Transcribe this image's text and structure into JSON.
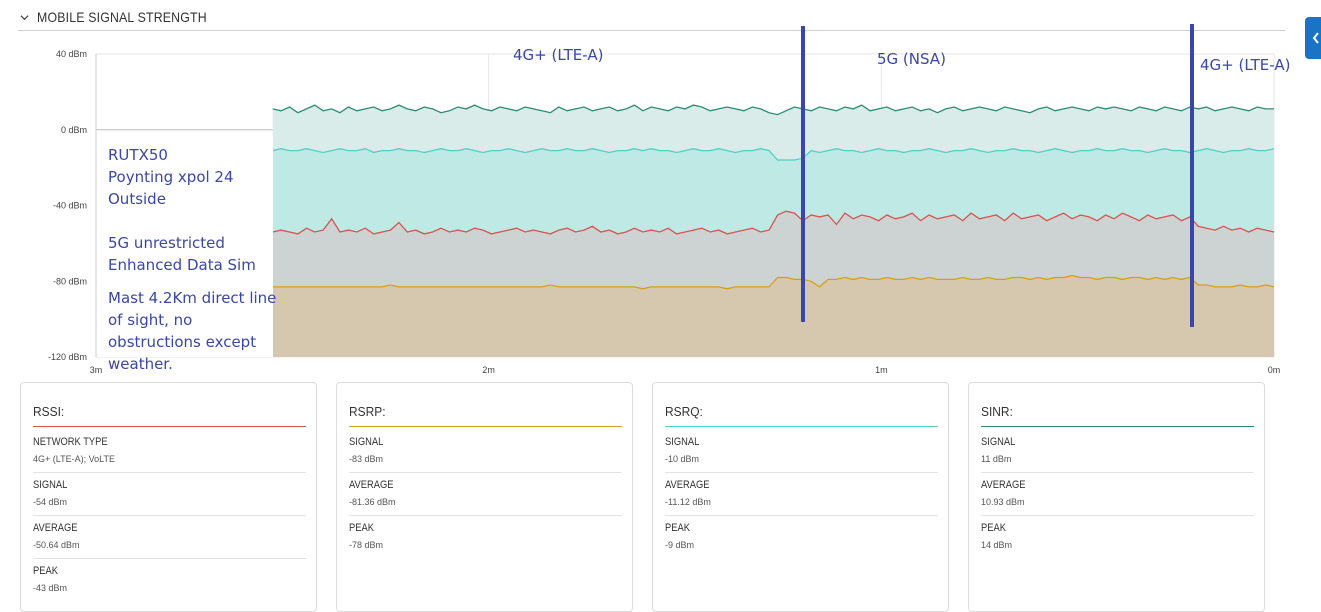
{
  "section": {
    "title": "MOBILE SIGNAL STRENGTH"
  },
  "colors": {
    "rssi": "#d9534f",
    "rsrp": "#d4a017",
    "rsrq": "#4dd0c8",
    "sinr": "#2e8b74",
    "overlay": "#3a46a8",
    "side_tab": "#1a73c5"
  },
  "icons": {
    "collapse": "chevron-down-icon",
    "side_tab": "chevron-left-icon"
  },
  "chart_data": {
    "type": "area",
    "x_ticks": [
      "3m",
      "2m",
      "1m",
      "0m"
    ],
    "y_ticks": [
      "40 dBm",
      "0 dBm",
      "-40 dBm",
      "-80 dBm",
      "-120 dBm"
    ],
    "ylim": [
      -120,
      40
    ],
    "xlim_minutes_ago": [
      3,
      0
    ],
    "data_start_minutes_ago": 2.55,
    "series": [
      {
        "name": "SINR",
        "key": "sinr",
        "values": [
          11,
          10,
          12,
          9,
          11,
          13,
          10,
          11,
          9,
          12,
          10,
          11,
          12,
          10,
          11,
          13,
          11,
          10,
          12,
          11,
          9,
          10,
          12,
          11,
          13,
          11,
          10,
          12,
          11,
          10,
          12,
          11,
          10,
          9,
          12,
          10,
          11,
          12,
          10,
          11,
          12,
          10,
          11,
          13,
          10,
          12,
          11,
          10,
          12,
          11,
          13,
          12,
          10,
          11,
          12,
          11,
          10,
          12,
          11,
          9,
          8,
          10,
          12,
          11,
          10,
          12,
          11,
          10,
          12,
          11,
          13,
          10,
          11,
          12,
          10,
          11,
          12,
          10,
          11,
          9,
          11,
          12,
          10,
          11,
          12,
          11,
          10,
          12,
          11,
          10,
          9,
          11,
          12,
          10,
          11,
          12,
          11,
          10,
          12,
          11,
          12,
          11,
          10,
          12,
          11,
          10,
          12,
          11,
          10,
          12,
          11,
          12,
          10,
          11,
          12,
          11,
          10,
          12,
          11,
          11
        ]
      },
      {
        "name": "RSRQ",
        "key": "rsrq",
        "values": [
          -11,
          -10,
          -11,
          -11,
          -10,
          -11,
          -12,
          -11,
          -10,
          -11,
          -11,
          -10,
          -12,
          -11,
          -11,
          -10,
          -11,
          -11,
          -12,
          -11,
          -10,
          -11,
          -11,
          -10,
          -11,
          -12,
          -11,
          -11,
          -10,
          -11,
          -12,
          -11,
          -10,
          -11,
          -11,
          -10,
          -11,
          -11,
          -10,
          -11,
          -12,
          -11,
          -11,
          -10,
          -11,
          -10,
          -11,
          -11,
          -12,
          -11,
          -10,
          -11,
          -11,
          -10,
          -11,
          -12,
          -11,
          -11,
          -10,
          -11,
          -16,
          -16,
          -16,
          -15,
          -11,
          -12,
          -11,
          -10,
          -11,
          -11,
          -12,
          -11,
          -10,
          -11,
          -11,
          -12,
          -11,
          -11,
          -10,
          -11,
          -12,
          -11,
          -11,
          -10,
          -11,
          -12,
          -11,
          -11,
          -10,
          -11,
          -11,
          -12,
          -11,
          -10,
          -11,
          -12,
          -11,
          -11,
          -10,
          -11,
          -11,
          -10,
          -11,
          -11,
          -12,
          -11,
          -10,
          -11,
          -11,
          -12,
          -11,
          -10,
          -11,
          -12,
          -11,
          -11,
          -10,
          -11,
          -11,
          -10
        ]
      },
      {
        "name": "RSSI",
        "key": "rssi",
        "values": [
          -54,
          -53,
          -54,
          -55,
          -52,
          -54,
          -53,
          -47,
          -54,
          -53,
          -54,
          -52,
          -55,
          -54,
          -53,
          -49,
          -54,
          -53,
          -55,
          -54,
          -52,
          -54,
          -53,
          -54,
          -52,
          -53,
          -55,
          -54,
          -53,
          -52,
          -54,
          -53,
          -54,
          -55,
          -53,
          -52,
          -54,
          -53,
          -51,
          -54,
          -53,
          -55,
          -54,
          -52,
          -54,
          -53,
          -54,
          -52,
          -55,
          -54,
          -53,
          -52,
          -54,
          -53,
          -55,
          -54,
          -53,
          -52,
          -54,
          -53,
          -45,
          -43,
          -44,
          -48,
          -45,
          -46,
          -45,
          -50,
          -44,
          -47,
          -45,
          -46,
          -48,
          -45,
          -47,
          -46,
          -44,
          -48,
          -45,
          -47,
          -46,
          -45,
          -48,
          -44,
          -47,
          -46,
          -45,
          -48,
          -44,
          -47,
          -46,
          -45,
          -48,
          -46,
          -44,
          -47,
          -45,
          -46,
          -48,
          -45,
          -47,
          -44,
          -46,
          -48,
          -45,
          -47,
          -46,
          -45,
          -48,
          -46,
          -51,
          -52,
          -53,
          -51,
          -53,
          -52,
          -54,
          -52,
          -53,
          -54
        ]
      },
      {
        "name": "RSRP",
        "key": "rsrp",
        "values": [
          -83,
          -83,
          -83,
          -83,
          -83,
          -83,
          -83,
          -83,
          -83,
          -83,
          -83,
          -83,
          -83,
          -83,
          -82,
          -83,
          -83,
          -83,
          -83,
          -83,
          -83,
          -83,
          -83,
          -83,
          -83,
          -83,
          -83,
          -83,
          -83,
          -83,
          -83,
          -83,
          -83,
          -82,
          -83,
          -83,
          -83,
          -83,
          -83,
          -83,
          -83,
          -83,
          -83,
          -83,
          -84,
          -83,
          -83,
          -83,
          -83,
          -83,
          -83,
          -83,
          -83,
          -83,
          -84,
          -83,
          -83,
          -83,
          -83,
          -83,
          -78,
          -78,
          -79,
          -79,
          -80,
          -83,
          -79,
          -79,
          -78,
          -79,
          -78,
          -79,
          -79,
          -78,
          -79,
          -79,
          -78,
          -79,
          -78,
          -79,
          -79,
          -79,
          -78,
          -79,
          -79,
          -78,
          -79,
          -79,
          -78,
          -78,
          -79,
          -78,
          -79,
          -78,
          -78,
          -77,
          -78,
          -78,
          -79,
          -78,
          -78,
          -79,
          -78,
          -78,
          -79,
          -78,
          -79,
          -78,
          -79,
          -78,
          -82,
          -82,
          -83,
          -83,
          -83,
          -82,
          -83,
          -83,
          -82,
          -83
        ]
      }
    ]
  },
  "overlays": {
    "bands": [
      "4G+ (LTE-A)",
      "5G (NSA)",
      "4G+ (LTE-A)"
    ],
    "notes": [
      "RUTX50",
      "Poynting xpol 24",
      "Outside",
      "5G unrestricted",
      "Enhanced Data Sim",
      "Mast 4.2Km direct line",
      "of sight, no",
      "obstructions except",
      "weather."
    ]
  },
  "cards": [
    {
      "title": "RSSI:",
      "color_key": "rssi",
      "rows": [
        {
          "label": "NETWORK TYPE",
          "value": "4G+ (LTE-A); VoLTE"
        },
        {
          "label": "SIGNAL",
          "value": "-54 dBm"
        },
        {
          "label": "AVERAGE",
          "value": "-50.64 dBm"
        },
        {
          "label": "PEAK",
          "value": "-43 dBm"
        }
      ]
    },
    {
      "title": "RSRP:",
      "color_key": "rsrp",
      "rows": [
        {
          "label": "SIGNAL",
          "value": "-83 dBm"
        },
        {
          "label": "AVERAGE",
          "value": "-81.36 dBm"
        },
        {
          "label": "PEAK",
          "value": "-78 dBm"
        }
      ]
    },
    {
      "title": "RSRQ:",
      "color_key": "rsrq",
      "rows": [
        {
          "label": "SIGNAL",
          "value": "-10 dBm"
        },
        {
          "label": "AVERAGE",
          "value": "-11.12 dBm"
        },
        {
          "label": "PEAK",
          "value": "-9 dBm"
        }
      ]
    },
    {
      "title": "SINR:",
      "color_key": "sinr",
      "rows": [
        {
          "label": "SIGNAL",
          "value": "11 dBm"
        },
        {
          "label": "AVERAGE",
          "value": "10.93 dBm"
        },
        {
          "label": "PEAK",
          "value": "14 dBm"
        }
      ]
    }
  ]
}
